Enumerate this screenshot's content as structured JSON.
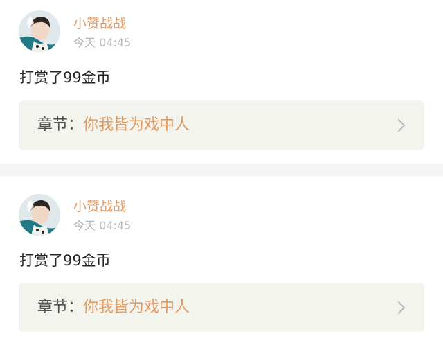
{
  "feed": {
    "items": [
      {
        "username": "小赞战战",
        "timestamp": "今天 04:45",
        "message": "打赏了99金币",
        "chapter_prefix": "章节：",
        "chapter_title": "你我皆为戏中人"
      },
      {
        "username": "小赞战战",
        "timestamp": "今天 04:45",
        "message": "打赏了99金币",
        "chapter_prefix": "章节：",
        "chapter_title": "你我皆为戏中人"
      }
    ]
  },
  "icons": {
    "avatar": "user-avatar-photo",
    "chevron": "chevron-right-icon"
  },
  "colors": {
    "accent": "#e29a62",
    "chapter_box_bg": "#f4f4ee",
    "separator": "#f6f4f4",
    "timestamp": "#b5b5b5",
    "text": "#262626"
  }
}
